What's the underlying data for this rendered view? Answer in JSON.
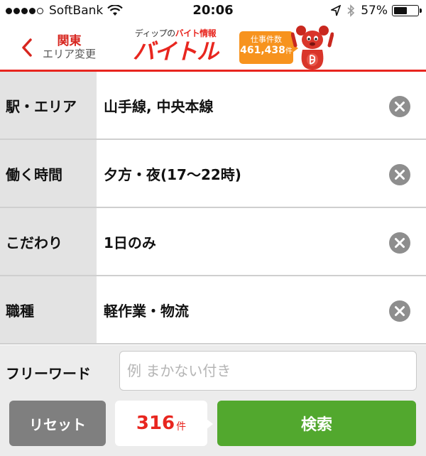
{
  "status_bar": {
    "carrier": "SoftBank",
    "time": "20:06",
    "battery_percent": "57%",
    "battery_level": 0.57
  },
  "header": {
    "back_region": "関東",
    "back_sublabel": "エリア変更",
    "logo_tagline_prefix": "ディップの",
    "logo_tagline_accent": "バイト情報",
    "logo_name": "バイトル",
    "jobs_label": "仕事件数",
    "jobs_count": "461,438",
    "jobs_unit": "件"
  },
  "filters": [
    {
      "label": "駅・エリア",
      "value": "山手線, 中央本線"
    },
    {
      "label": "働く時間",
      "value": "夕方・夜(17〜22時)"
    },
    {
      "label": "こだわり",
      "value": "1日のみ"
    },
    {
      "label": "職種",
      "value": "軽作業・物流"
    }
  ],
  "freeword": {
    "label": "フリーワード",
    "placeholder": "例 まかない付き",
    "value": ""
  },
  "actions": {
    "reset_label": "リセット",
    "result_count": "316",
    "result_unit": "件",
    "search_label": "検索"
  },
  "colors": {
    "brand_red": "#e8261f",
    "badge_orange": "#f7931e",
    "search_green": "#52a82e",
    "reset_gray": "#7f7f7f"
  },
  "icons": [
    "signal-dots-icon",
    "wifi-icon",
    "location-arrow-icon",
    "bluetooth-icon",
    "battery-icon",
    "chevron-left-icon",
    "mascot-icon",
    "clear-icon"
  ]
}
